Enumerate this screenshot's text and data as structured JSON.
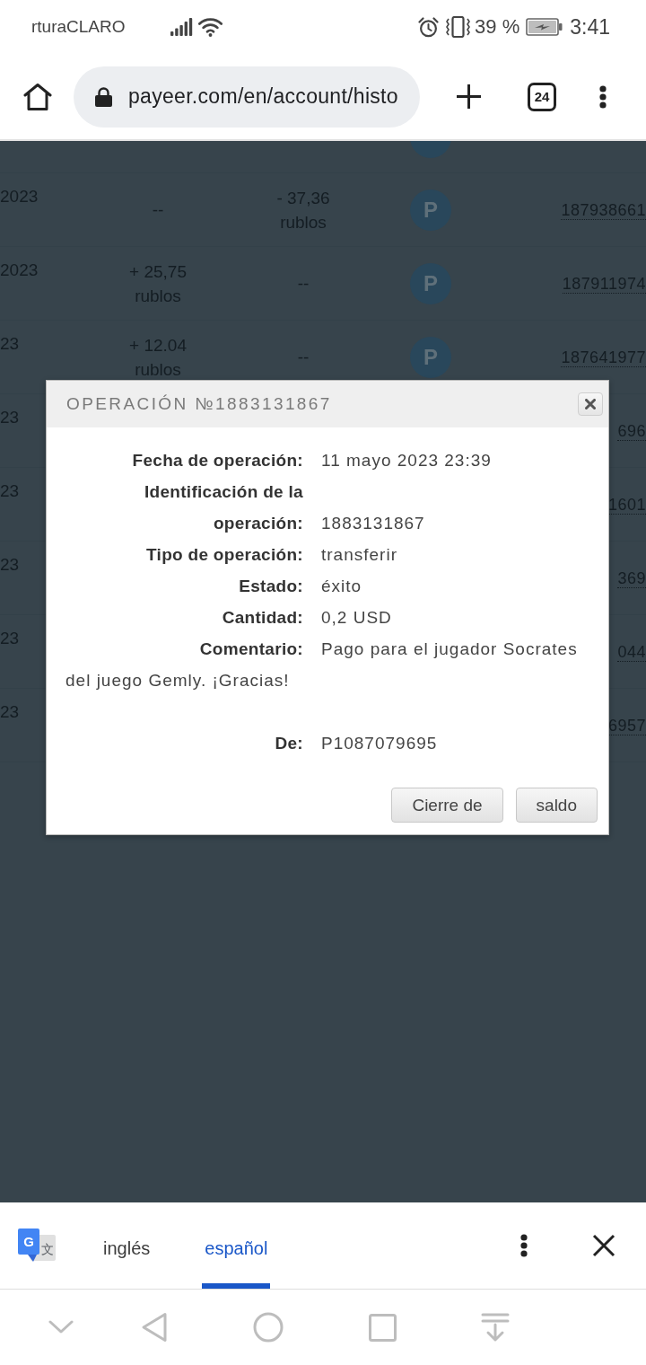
{
  "status_bar": {
    "carrier": "rturaCLARO",
    "battery": "39 %",
    "time": "3:41"
  },
  "browser_bar": {
    "url": "payeer.com/en/account/histo",
    "tab_count": "24"
  },
  "history_table": {
    "rows": [
      {
        "column_1": "2023",
        "column_2": "--",
        "column_3": "- 37,36 rublos",
        "column_4": "P",
        "column_5": "187938661"
      },
      {
        "column_1": "2023",
        "column_2": "+ 25,75 rublos",
        "column_3": "--",
        "column_4": "P",
        "column_5": "187911974"
      },
      {
        "column_1": "23",
        "column_2": "+ 12.04 rublos",
        "column_3": "--",
        "column_4": "P",
        "column_5": "187641977"
      },
      {
        "column_1": "23",
        "column_5": "696"
      },
      {
        "column_1": "23",
        "column_5": "1601"
      },
      {
        "column_1": "23",
        "column_5": "369"
      },
      {
        "column_1": "23",
        "column_5": "044"
      },
      {
        "column_1": "23",
        "column_5": "6957"
      }
    ]
  },
  "dialog": {
    "title": "OPERACIÓN №1883131867",
    "fields": [
      {
        "label": "Fecha de operación:",
        "value": "11 mayo 2023 23:39"
      },
      {
        "label": "Identificación de la operación:",
        "value": "1883131867"
      },
      {
        "label": "Tipo de operación:",
        "value": "transferir"
      },
      {
        "label": "Estado:",
        "value": "éxito"
      },
      {
        "label": "Cantidad:",
        "value": "0,2 USD"
      }
    ],
    "comment": {
      "label": "Comentario:",
      "value": "Pago para el jugador Socrates del juego Gemly. ¡Gracias!"
    },
    "sender": {
      "label": "De:",
      "value": "P1087079695"
    },
    "buttons": [
      "Cierre de",
      "saldo"
    ]
  },
  "translate_bar": {
    "logo": {
      "front": "G",
      "back": "文"
    },
    "languages": [
      {
        "label": "inglés",
        "selected": false
      },
      {
        "label": "español",
        "selected": true
      }
    ]
  }
}
